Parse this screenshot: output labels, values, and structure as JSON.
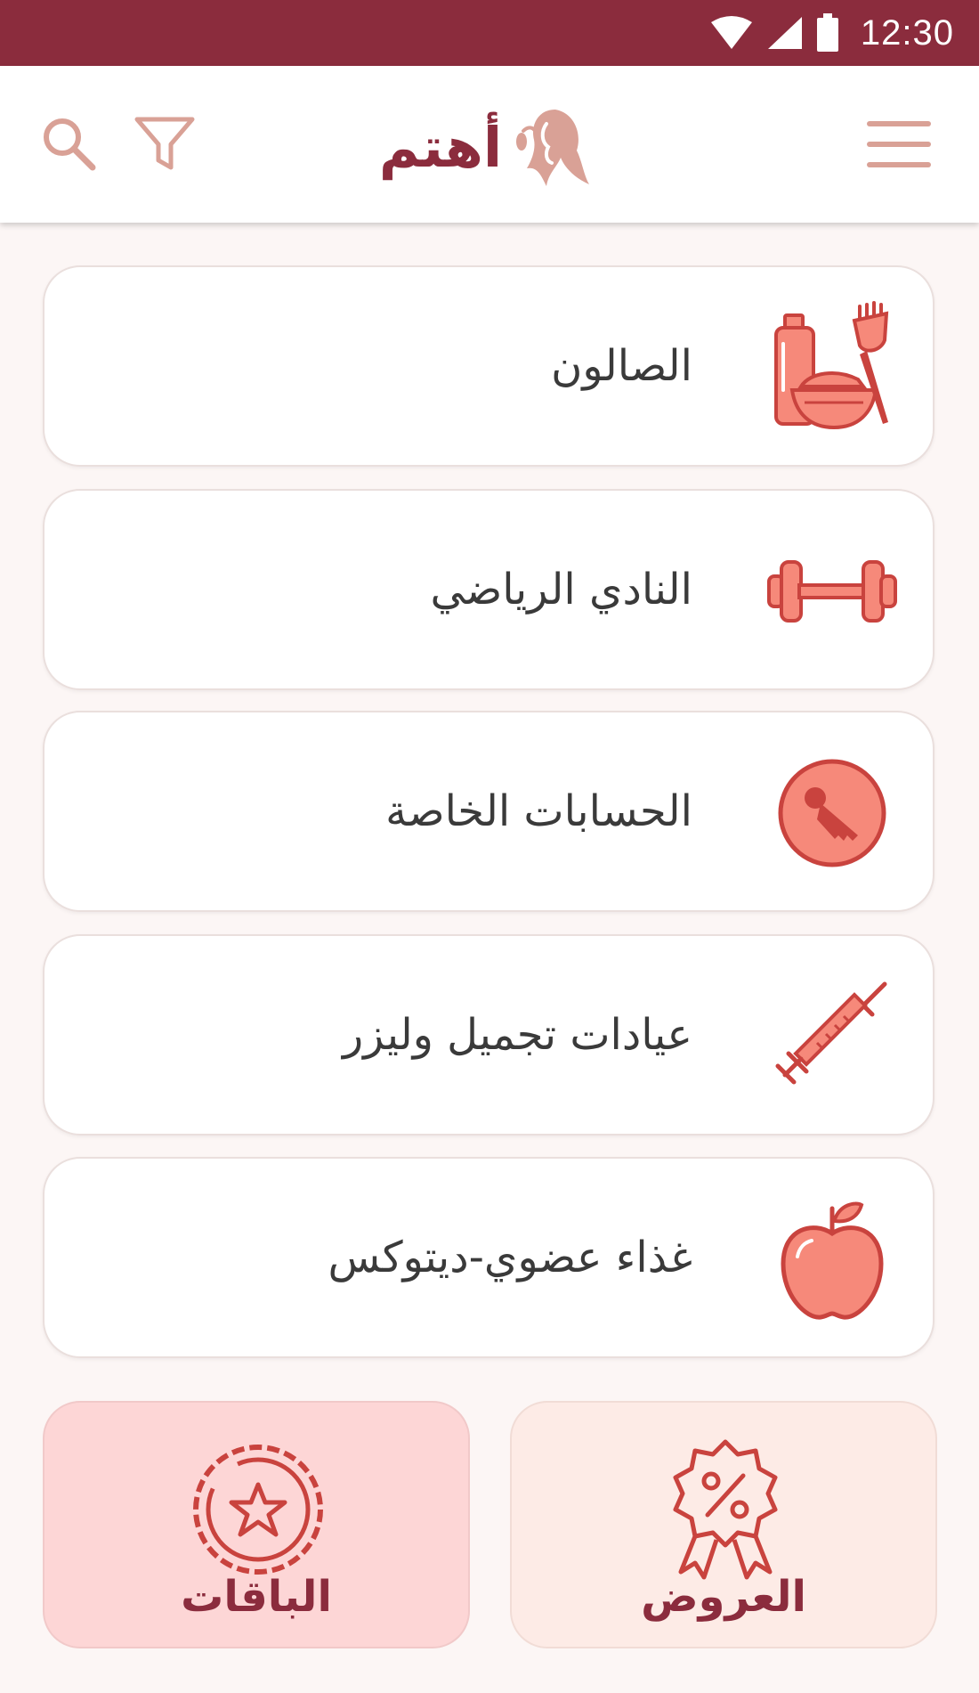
{
  "status_bar": {
    "time": "12:30",
    "icons": [
      "wifi-icon",
      "signal-icon",
      "battery-icon"
    ],
    "background": "#8b2c3d"
  },
  "app_bar": {
    "logo_text": "أهتم",
    "logo_icon": "woman-silhouette-icon",
    "left_icons": [
      "search-icon",
      "filter-icon"
    ],
    "right_icon": "hamburger-menu-icon"
  },
  "categories": [
    {
      "label": "الصالون",
      "icon": "salon-products-icon"
    },
    {
      "label": "النادي الرياضي",
      "icon": "dumbbell-icon"
    },
    {
      "label": "الحسابات الخاصة",
      "icon": "key-icon"
    },
    {
      "label": "عيادات تجميل وليزر",
      "icon": "syringe-icon"
    },
    {
      "label": "غذاء عضوي-ديتوكس",
      "icon": "apple-icon"
    }
  ],
  "bottom_tiles": {
    "packages": {
      "label": "الباقات",
      "icon": "star-badge-icon",
      "background": "#fdd6d6"
    },
    "offers": {
      "label": "العروض",
      "icon": "percent-badge-icon",
      "background": "#fdebe6"
    }
  },
  "colors": {
    "brand": "#8b2c3d",
    "accent_icon": "#d9a196",
    "icon_fill": "#f6897a",
    "icon_stroke": "#c9433e"
  }
}
